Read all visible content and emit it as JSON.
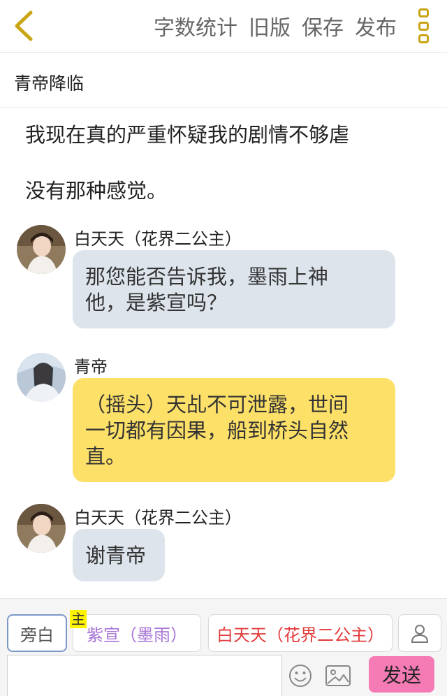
{
  "header": {
    "actions": [
      "字数统计",
      "旧版",
      "保存",
      "发布"
    ]
  },
  "title": "青帝降临",
  "narration": [
    "我现在真的严重怀疑我的剧情不够虐",
    "没有那种感觉。"
  ],
  "messages": [
    {
      "sender": "白天天（花界二公主）",
      "text_lines": [
        "那您能否告诉我，墨雨上神",
        "他，是紫宣吗？"
      ],
      "bubble_color": "#dde4ec"
    },
    {
      "sender": "青帝",
      "text_lines": [
        "（摇头）天乩不可泄露，世间",
        "一切都有因果，船到桥头自然",
        "直。"
      ],
      "bubble_color": "#fce068"
    },
    {
      "sender": "白天天（花界二公主）",
      "text_lines": [
        "谢青帝"
      ],
      "bubble_color": "#dde4ec"
    }
  ],
  "toolbar": {
    "narrator": "旁白",
    "main_badge": "主",
    "role_zixuan": "紫宣（墨雨）",
    "role_baitiantian": "白天天（花界二公主）",
    "send": "发送"
  },
  "colors": {
    "accent_yellow": "#c9a413",
    "send_pink": "#f57bb5",
    "zixuan_purple": "#a774d6",
    "baitiantian_red": "#e33b3b"
  },
  "icons": [
    "back-icon",
    "more-icon",
    "person-icon",
    "emoji-icon",
    "image-icon"
  ]
}
